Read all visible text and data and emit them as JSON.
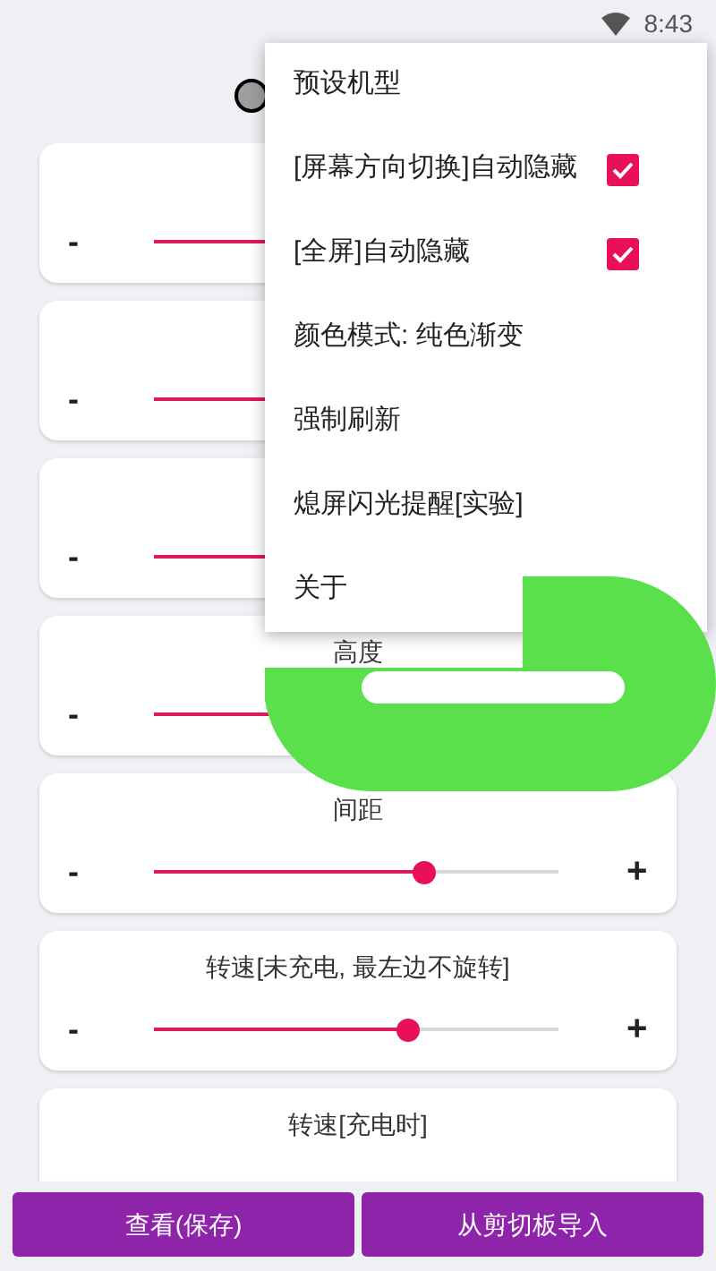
{
  "status_bar": {
    "time": "8:43"
  },
  "cards": [
    {
      "minus": "-"
    },
    {
      "minus": "-"
    },
    {
      "minus": "-"
    },
    {
      "title": "高度",
      "minus": "-"
    },
    {
      "title": "间距",
      "minus": "-",
      "plus": "+",
      "level": 0.67
    },
    {
      "title": "转速[未充电, 最左边不旋转]",
      "minus": "-",
      "plus": "+",
      "level": 0.63
    },
    {
      "title": "转速[充电时]"
    }
  ],
  "menu": [
    {
      "kind": "text",
      "label": "预设机型"
    },
    {
      "kind": "checkbox",
      "label": "[屏幕方向切换]自动隐藏",
      "checked": true
    },
    {
      "kind": "checkbox",
      "label": "[全屏]自动隐藏",
      "checked": true
    },
    {
      "kind": "text",
      "label": "颜色模式: 纯色渐变"
    },
    {
      "kind": "text",
      "label": "强制刷新"
    },
    {
      "kind": "text",
      "label": "熄屏闪光提醒[实验]"
    },
    {
      "kind": "text",
      "label": "关于"
    }
  ],
  "buttons": [
    "查看(保存)",
    "从剪切板导入"
  ]
}
